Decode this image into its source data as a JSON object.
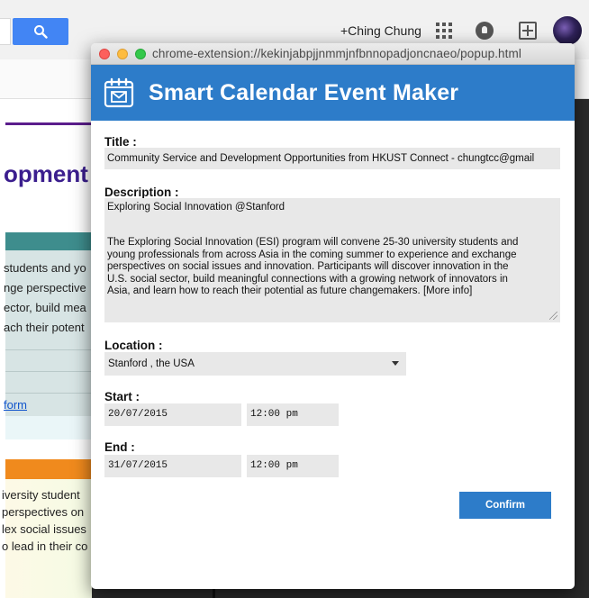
{
  "background": {
    "account_name": "+Ching Chung",
    "doc_heading": "opment",
    "teal_lines": [
      "students and yo",
      "nge perspective",
      "ector, build mea",
      "ach their potent"
    ],
    "form_link": "form",
    "yellow_lines": [
      "iversity student",
      "perspectives on",
      "lex social issues",
      "o lead in their co"
    ]
  },
  "window": {
    "url": "chrome-extension://kekinjabpjjnmmjnfbnnopadjoncnaeo/popup.html"
  },
  "app": {
    "title": "Smart Calendar Event Maker",
    "accent_color": "#2d7cc9"
  },
  "form": {
    "title_label": "Title",
    "title_value": "Community Service and Development Opportunities from HKUST Connect - chungtcc@gmail",
    "description_label": "Description",
    "description_line1": "Exploring Social Innovation @Stanford",
    "description_para": "The Exploring Social Innovation (ESI) program will convene 25-30 university students and\nyoung professionals from across Asia in the coming summer to experience and exchange\nperspectives on social issues and innovation. Participants will discover innovation in the\nU.S. social sector, build meaningful connections with a growing network of innovators in\nAsia, and learn how to reach their potential as future changemakers. [More info]",
    "location_label": "Location",
    "location_value": "Stanford , the USA",
    "start_label": "Start",
    "start_date": "20/07/2015",
    "start_time": "12:00 pm",
    "end_label": "End",
    "end_date": "31/07/2015",
    "end_time": "12:00 pm",
    "colon": ":",
    "confirm_label": "Confirm"
  }
}
